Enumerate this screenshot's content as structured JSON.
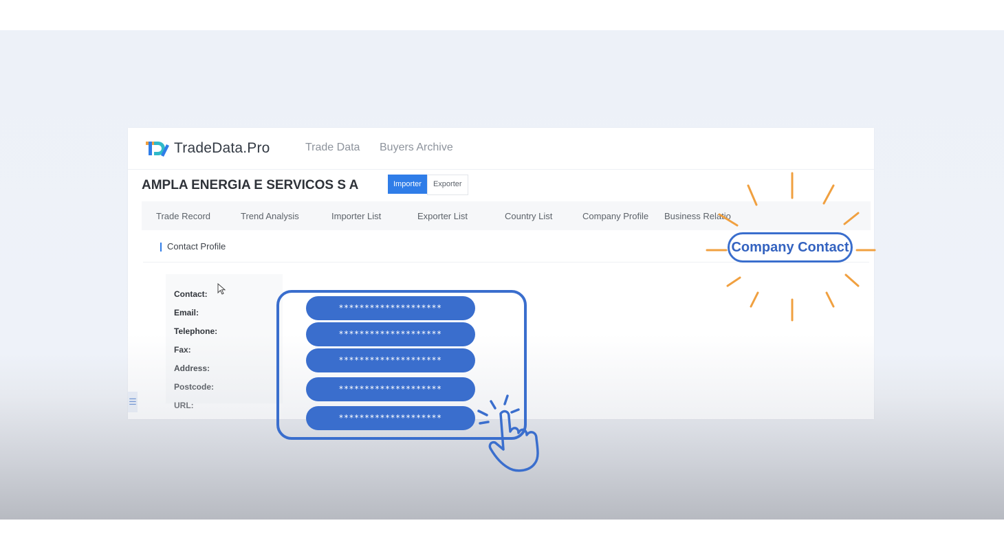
{
  "brand": {
    "name": "TradeData.Pro"
  },
  "nav": {
    "trade_data": "Trade Data",
    "buyers_archive": "Buyers Archive"
  },
  "company": {
    "name": "AMPLA ENERGIA E SERVICOS S A"
  },
  "role_toggle": {
    "importer": "Importer",
    "exporter": "Exporter"
  },
  "tabs": [
    {
      "label": "Trade Record"
    },
    {
      "label": "Trend Analysis"
    },
    {
      "label": "Importer List"
    },
    {
      "label": "Exporter List"
    },
    {
      "label": "Country List"
    },
    {
      "label": "Company Profile"
    },
    {
      "label": "Business Relatio"
    }
  ],
  "highlight": {
    "label": "Company Contact"
  },
  "section": {
    "title": "Contact Profile"
  },
  "fields": [
    {
      "label": "Contact:"
    },
    {
      "label": "Email:"
    },
    {
      "label": "Telephone:"
    },
    {
      "label": "Fax:"
    },
    {
      "label": "Address:"
    },
    {
      "label": "Postcode:"
    },
    {
      "label": "URL:"
    }
  ],
  "masked_values": [
    "********************",
    "********************",
    "********************",
    "********************",
    "********************"
  ],
  "side_tab": {
    "glyph": "☰"
  },
  "colors": {
    "accent": "#2f7de8",
    "overlay_blue": "#3a6ecd",
    "burst_orange": "#f0a040"
  },
  "icons": {
    "cursor": "cursor-arrow-icon",
    "hand": "pointing-hand-icon",
    "burst": "sunburst-icon"
  }
}
